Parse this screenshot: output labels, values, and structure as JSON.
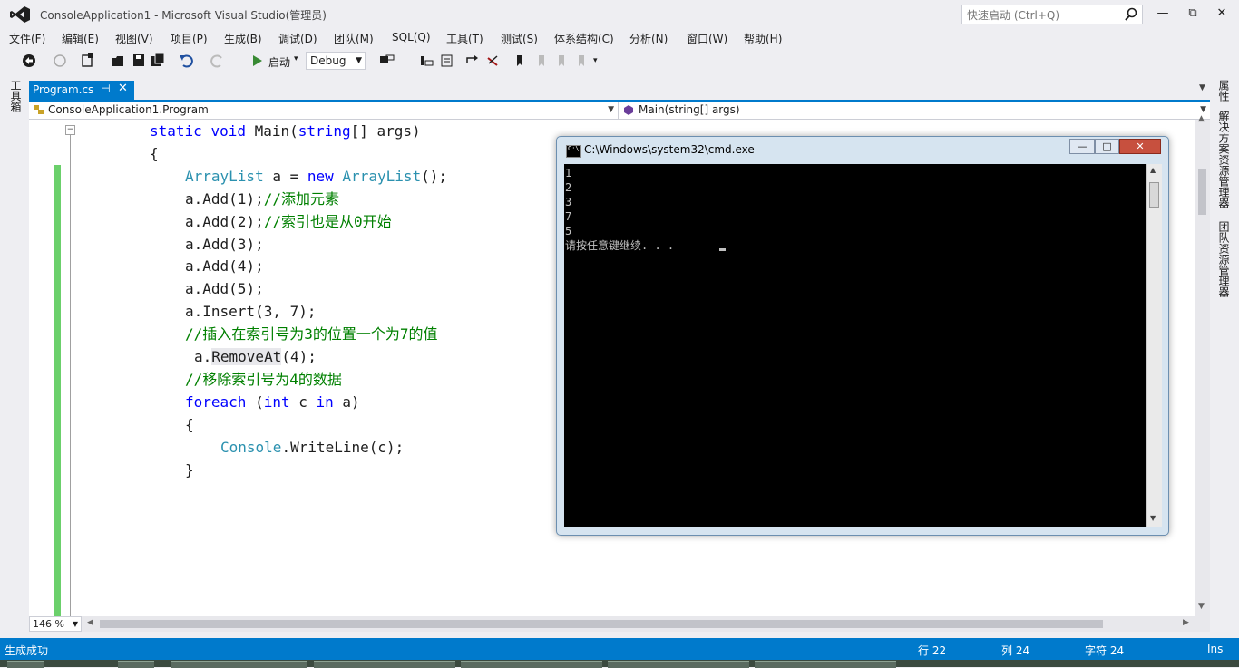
{
  "window": {
    "title": "ConsoleApplication1 - Microsoft Visual Studio(管理员)",
    "quick_launch_placeholder": "快速启动 (Ctrl+Q)",
    "minimize": "—",
    "restore": "⧉",
    "close": "✕"
  },
  "menu": [
    "文件(F)",
    "编辑(E)",
    "视图(V)",
    "项目(P)",
    "生成(B)",
    "调试(D)",
    "团队(M)",
    "SQL(Q)",
    "工具(T)",
    "测试(S)",
    "体系结构(C)",
    "分析(N)",
    "窗口(W)",
    "帮助(H)"
  ],
  "toolbar": {
    "start_label": "启动",
    "config": "Debug"
  },
  "left_panel": {
    "toolbox": "工具箱"
  },
  "right_panel": {
    "properties": "属性",
    "solution_explorer": "解决方案资源管理器",
    "team_explorer": "团队资源管理器"
  },
  "tab": {
    "name": "Program.cs",
    "pin": "⊣",
    "close": "✕"
  },
  "navbar": {
    "type_combo": "ConsoleApplication1.Program",
    "member_combo": "Main(string[] args)"
  },
  "code": {
    "l1_kw1": "static",
    "l1_kw2": "void",
    "l1_rest": "Main(",
    "l1_kw3": "string",
    "l1_end": "[] args)",
    "l2": "{",
    "l3_t1": "ArrayList",
    "l3_mid": " a = ",
    "l3_kw": "new",
    "l3_t2": "ArrayList",
    "l3_end": "();",
    "l4_code": "a.Add(1);",
    "l4_cm": "//添加元素",
    "l5_code": "a.Add(2);",
    "l5_cm": "//索引也是从0开始",
    "l6": "a.Add(3);",
    "l7": "a.Add(4);",
    "l8": "a.Add(5);",
    "l9": "a.Insert(3, 7);",
    "l10_cm": "//插入在索引号为3的位置一个为7的值",
    "l11_a": "a.",
    "l11_hl": "RemoveAt",
    "l11_end": "(4);",
    "l12_cm": "//移除索引号为4的数据",
    "l13_kw1": "foreach",
    "l13_p": " (",
    "l13_kw2": "int",
    "l13_c": " c ",
    "l13_kw3": "in",
    "l13_end": " a)",
    "l14": "{",
    "l15_t": "Console",
    "l15_end": ".WriteLine(c);",
    "l16": "}"
  },
  "zoom": "146 %",
  "status": {
    "message": "生成成功",
    "row": "行 22",
    "col": "列 24",
    "char": "字符 24",
    "mode": "Ins"
  },
  "cmd": {
    "title": "C:\\Windows\\system32\\cmd.exe",
    "icon_text": "C:\\",
    "lines": [
      "1",
      "2",
      "3",
      "7",
      "5",
      "请按任意键继续. . ."
    ],
    "min": "—",
    "max": "□",
    "close": "✕"
  }
}
